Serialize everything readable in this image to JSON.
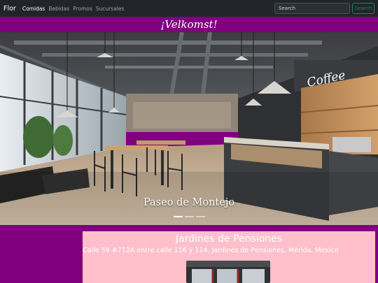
{
  "navbar": {
    "brand": "Flor",
    "links": [
      {
        "label": "Comidas",
        "active": true
      },
      {
        "label": "Bebidas",
        "active": false
      },
      {
        "label": "Promos",
        "active": false
      },
      {
        "label": "Sucursales",
        "active": false
      }
    ],
    "search_placeholder": "Search",
    "search_button": "Search"
  },
  "welcome": "¡Velkomst!",
  "carousel": {
    "caption": "Paseo de Montejo",
    "slide_count": 3,
    "active_index": 0,
    "sign_text": "Coffee"
  },
  "branch": {
    "name": "Jardines de Pensiones",
    "address": "Calle 59 #712A entre calle 116 y 114, Jardines de Pensiones, Mérida, Mexico"
  },
  "colors": {
    "navbar_bg": "#212529",
    "band": "#800080",
    "card": "#ffc0cb",
    "search_button": "#198754"
  }
}
